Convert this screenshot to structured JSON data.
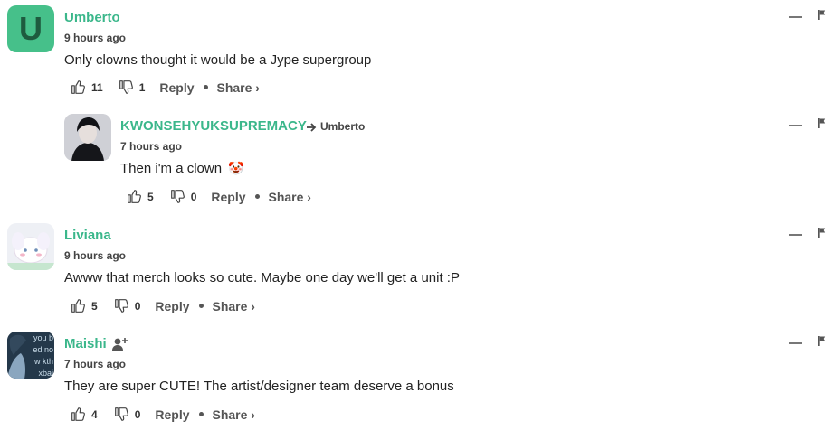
{
  "colors": {
    "author": "#3bb78b",
    "avatar_u": "#46c08a"
  },
  "comments": [
    {
      "author": "Umberto",
      "avatar_letter": "U",
      "time": "9 hours ago",
      "text": "Only clowns thought it would be a Jype supergroup",
      "likes": "11",
      "dislikes": "1",
      "reply_label": "Reply",
      "share_label": "Share ›"
    },
    {
      "author": "KWONSEHYUKSUPREMACY",
      "reply_to": "Umberto",
      "time": "7 hours ago",
      "text": "Then i'm a clown",
      "emoji": "🤡",
      "likes": "5",
      "dislikes": "0",
      "reply_label": "Reply",
      "share_label": "Share ›"
    },
    {
      "author": "Liviana",
      "time": "9 hours ago",
      "text": "Awww that merch looks so cute. Maybe one day we'll get a unit :P",
      "likes": "5",
      "dislikes": "0",
      "reply_label": "Reply",
      "share_label": "Share ›"
    },
    {
      "author": "Maishi",
      "time": "7 hours ago",
      "avatar_text": "you bed now kthxbai",
      "text": "They are super CUTE! The artist/designer team deserve a bonus",
      "likes": "4",
      "dislikes": "0",
      "reply_label": "Reply",
      "share_label": "Share ›"
    }
  ]
}
